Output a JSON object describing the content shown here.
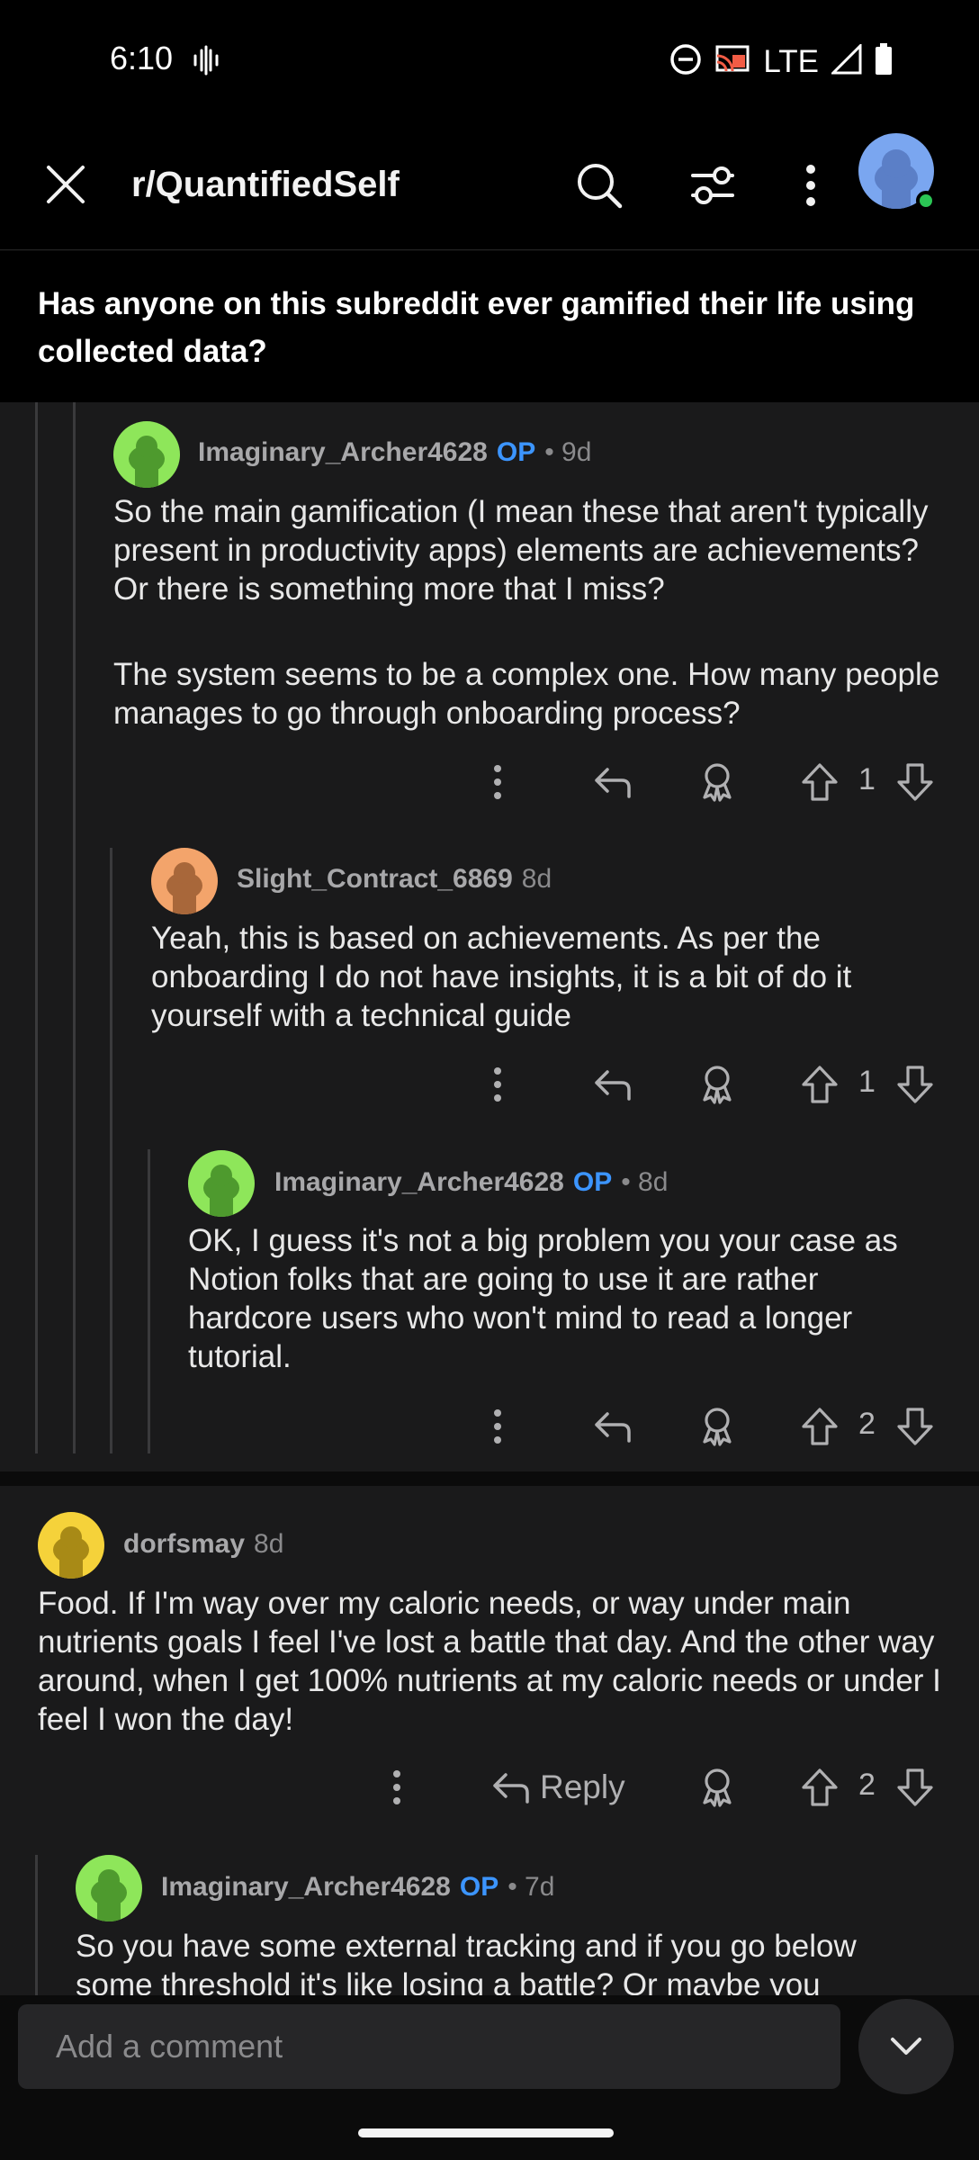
{
  "status_bar": {
    "time": "6:10",
    "network": "LTE"
  },
  "header": {
    "close_icon": "close-icon",
    "subreddit": "r/QuantifiedSelf",
    "icons": [
      "search-icon",
      "filter-icon",
      "more-vert-icon"
    ]
  },
  "post": {
    "title": "Has anyone on this subreddit ever gamified their life using collected data?"
  },
  "comments": [
    {
      "author": "Imaginary_Archer4628",
      "op_badge": "OP",
      "age": "• 9d",
      "avatar_color": "#8ee65a",
      "paragraphs": [
        "So the main gamification (I mean these that aren't typically present in productivity apps) elements are achievements? Or there is something more that I miss?",
        "The system seems to be a complex one. How many people manages to go through onboarding process?"
      ],
      "votes": "1"
    },
    {
      "author": "Slight_Contract_6869",
      "age": "8d",
      "avatar_color": "#f3a46b",
      "paragraphs": [
        "Yeah, this is based on achievements. As per the onboarding I do not have insights, it is a bit of do it yourself with a technical guide"
      ],
      "votes": "1"
    },
    {
      "author": "Imaginary_Archer4628",
      "op_badge": "OP",
      "age": "• 8d",
      "avatar_color": "#8ee65a",
      "paragraphs": [
        "OK, I guess it's not a big problem you your case as Notion folks that are going to use it are rather hardcore users who won't mind to read a longer tutorial."
      ],
      "votes": "2"
    },
    {
      "author": "dorfsmay",
      "age": "8d",
      "avatar_color": "#f5d23a",
      "paragraphs": [
        "Food. If I'm way over my caloric needs, or way under main nutrients goals I feel I've lost a battle that day. And the other way around, when I get 100% nutrients at my caloric needs or under I feel I won the day!"
      ],
      "reply_label": "Reply",
      "votes": "2"
    },
    {
      "author": "Imaginary_Archer4628",
      "op_badge": "OP",
      "age": "• 7d",
      "avatar_color": "#8ee65a",
      "paragraphs": [
        "So you have some external tracking and if you go below some threshold it's like losing a battle? Or maybe you"
      ]
    }
  ],
  "comment_input": {
    "placeholder": "Add a comment"
  },
  "colors": {
    "background": "#1a1a1b",
    "op": "#3c95ff",
    "online": "#2bc655"
  }
}
